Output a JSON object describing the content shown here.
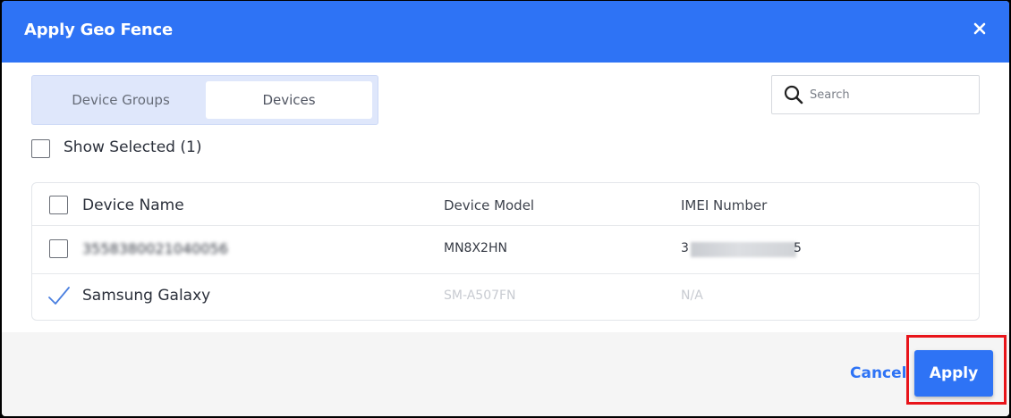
{
  "dialog": {
    "title": "Apply Geo Fence",
    "close_icon": "close-icon",
    "accent_color": "#2e73f5"
  },
  "tabs": [
    {
      "label": "Device Groups",
      "selected": false
    },
    {
      "label": "Devices",
      "selected": true
    }
  ],
  "search": {
    "placeholder": "Search",
    "value": "",
    "icon": "search-icon"
  },
  "show_selected": {
    "label": "Show Selected (1)",
    "checked": false
  },
  "table": {
    "headers": [
      "Device Name",
      "Device Model",
      "IMEI Number"
    ],
    "rows": [
      {
        "name": "3558380021040056",
        "model": "MN8X2HN",
        "imei_prefix": "3",
        "imei_suffix": "5",
        "checked": false
      },
      {
        "name": "Samsung Galaxy",
        "model": "SM-A507FN",
        "imei": "N/A",
        "checked": true
      }
    ]
  },
  "footer": {
    "cancel_label": "Cancel",
    "apply_label": "Apply",
    "highlight_color": "#e8141a"
  }
}
